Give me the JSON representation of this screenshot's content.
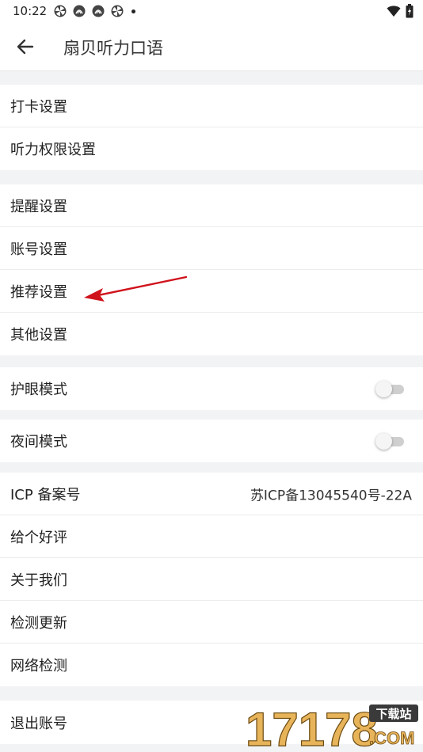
{
  "status_bar": {
    "time": "10:22"
  },
  "app_bar": {
    "title": "扇贝听力口语"
  },
  "sections": {
    "s1": [
      "打卡设置",
      "听力权限设置"
    ],
    "s2": [
      "提醒设置",
      "账号设置",
      "推荐设置",
      "其他设置"
    ],
    "eye_mode": {
      "label": "护眼模式",
      "on": false
    },
    "night_mode": {
      "label": "夜间模式",
      "on": false
    },
    "s5": {
      "icp_label": "ICP 备案号",
      "icp_value": "苏ICP备13045540号-22A",
      "rate": "给个好评",
      "about": "关于我们",
      "update": "检测更新",
      "network": "网络检测"
    },
    "logout": "退出账号"
  },
  "watermark": {
    "number": "17178",
    "tag": "下载站",
    "domain": ".COM"
  },
  "colors": {
    "annotation_arrow": "#d0121b",
    "divider_bg": "#f2f3f5"
  }
}
